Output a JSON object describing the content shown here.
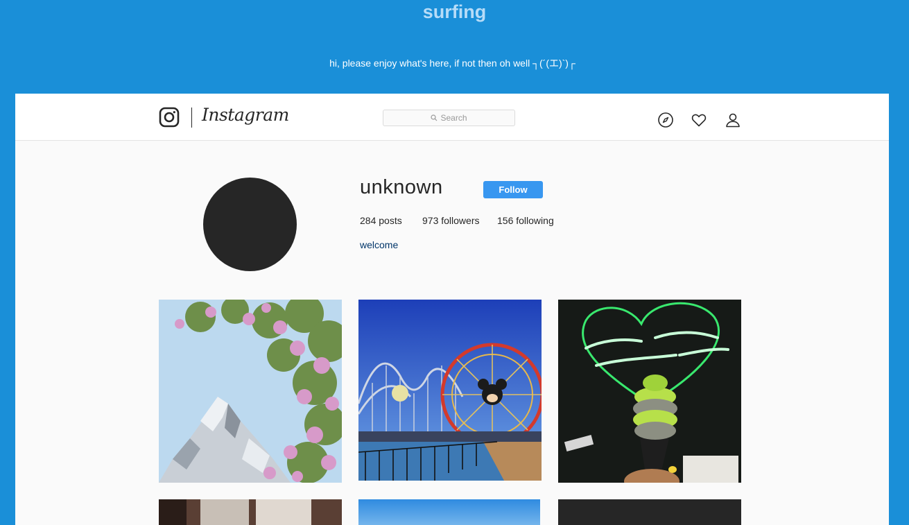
{
  "page": {
    "title": "surfing",
    "tagline": "hi, please enjoy what's here, if not then oh well ┐(´(エ)`)┌"
  },
  "navbar": {
    "wordmark": "Instagram",
    "search_placeholder": "Search",
    "icons": [
      "instagram-logo-icon",
      "compass-icon",
      "heart-icon",
      "user-icon",
      "search-icon"
    ]
  },
  "profile": {
    "username": "unknown",
    "follow_label": "Follow",
    "stats": {
      "posts": "284 posts",
      "followers": "973 followers",
      "following": "156 following"
    },
    "bio": "welcome"
  },
  "posts": [
    {
      "subject": "snowy mountain with pink flowering tree"
    },
    {
      "subject": "amusement park ferris wheel and roller coaster over water"
    },
    {
      "subject": "green soft-serve cone under neon sign",
      "sign_text": "We're a matcha made in heaven"
    },
    {
      "subject": "dim interior with door"
    },
    {
      "subject": "blue sky"
    },
    {
      "subject": "dark photo"
    }
  ],
  "colors": {
    "page_background": "#1a8fd8",
    "title": "#b6dcf8",
    "follow_button": "#3897f0",
    "bio_link": "#003569",
    "neon_green": "#3dff78"
  }
}
